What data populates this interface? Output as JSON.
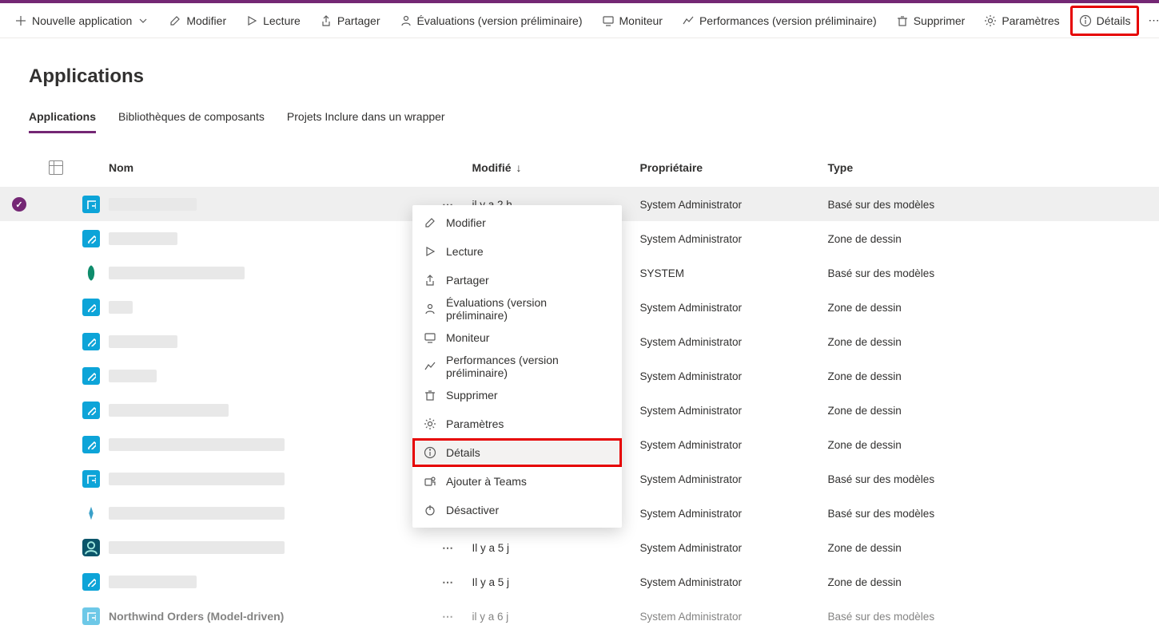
{
  "toolbar": {
    "new_app": "Nouvelle application",
    "modify": "Modifier",
    "play": "Lecture",
    "share": "Partager",
    "evaluations": "Évaluations (version préliminaire)",
    "monitor": "Moniteur",
    "performance": "Performances (version préliminaire)",
    "delete": "Supprimer",
    "settings": "Paramètres",
    "details": "Détails"
  },
  "page_title": "Applications",
  "tabs": {
    "applications": "Applications",
    "component_libs": "Bibliothèques de composants",
    "wrapper_projects": "Projets Inclure dans un wrapper"
  },
  "columns": {
    "name": "Nom",
    "modified": "Modifié",
    "owner": "Propriétaire",
    "type": "Type"
  },
  "rows": [
    {
      "icon": "model",
      "selected": true,
      "name": "",
      "name_redacted": true,
      "name_w": "w100",
      "modified": "il y a 2 h",
      "owner": "System Administrator",
      "type": "Basé sur des modèles"
    },
    {
      "icon": "canvas",
      "selected": false,
      "name": "",
      "name_redacted": true,
      "name_w": "w80",
      "modified": "",
      "owner": "System Administrator",
      "type": "Zone de dessin"
    },
    {
      "icon": "green",
      "selected": false,
      "name": "",
      "name_redacted": true,
      "name_w": "w170",
      "modified": "",
      "owner": "SYSTEM",
      "type": "Basé sur des modèles"
    },
    {
      "icon": "canvas",
      "selected": false,
      "name": "",
      "name_redacted": true,
      "name_w": "w30",
      "modified": "",
      "owner": "System Administrator",
      "type": "Zone de dessin"
    },
    {
      "icon": "canvas",
      "selected": false,
      "name": "",
      "name_redacted": true,
      "name_w": "w80",
      "modified": "",
      "owner": "System Administrator",
      "type": "Zone de dessin"
    },
    {
      "icon": "canvas",
      "selected": false,
      "name": "",
      "name_redacted": true,
      "name_w": "w60",
      "modified": "",
      "owner": "System Administrator",
      "type": "Zone de dessin"
    },
    {
      "icon": "canvas",
      "selected": false,
      "name": "",
      "name_redacted": true,
      "name_w": "w140",
      "modified": "",
      "owner": "System Administrator",
      "type": "Zone de dessin"
    },
    {
      "icon": "canvas",
      "selected": false,
      "name": "",
      "name_redacted": true,
      "name_w": "w200",
      "modified": "",
      "owner": "System Administrator",
      "type": "Zone de dessin"
    },
    {
      "icon": "model",
      "selected": false,
      "name": "",
      "name_redacted": true,
      "name_w": "w200",
      "modified": "",
      "owner": "System Administrator",
      "type": "Basé sur des modèles"
    },
    {
      "icon": "other",
      "selected": false,
      "name": "",
      "name_redacted": true,
      "name_w": "w200",
      "modified": "",
      "owner": "System Administrator",
      "type": "Basé sur des modèles"
    },
    {
      "icon": "teal",
      "selected": false,
      "name": "",
      "name_redacted": true,
      "name_w": "w200",
      "modified": "Il y a 5 j",
      "owner": "System Administrator",
      "type": "Zone de dessin"
    },
    {
      "icon": "canvas",
      "selected": false,
      "name": "",
      "name_redacted": true,
      "name_w": "w100",
      "modified": "Il y a 5 j",
      "owner": "System Administrator",
      "type": "Zone de dessin"
    },
    {
      "icon": "model",
      "selected": false,
      "name": "Northwind Orders (Model-driven)",
      "name_redacted": false,
      "modified": "il y a 6 j",
      "owner": "System Administrator",
      "type": "Basé sur des modèles",
      "faded": true
    }
  ],
  "context_menu": {
    "modify": "Modifier",
    "play": "Lecture",
    "share": "Partager",
    "evaluations": "Évaluations (version préliminaire)",
    "monitor": "Moniteur",
    "performance": "Performances (version préliminaire)",
    "delete": "Supprimer",
    "settings": "Paramètres",
    "details": "Détails",
    "add_to_teams": "Ajouter à Teams",
    "deactivate": "Désactiver"
  }
}
